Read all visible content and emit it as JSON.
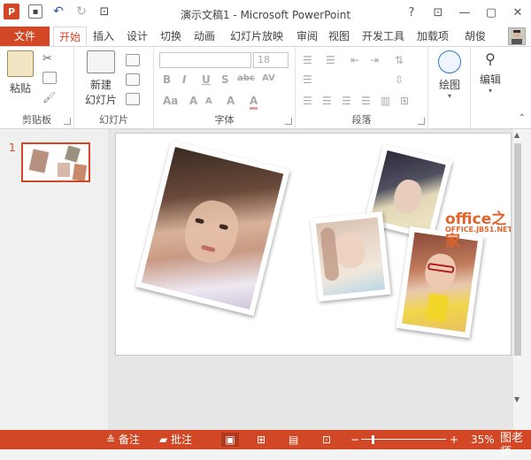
{
  "app": {
    "window_title": "演示文稿1 - Microsoft PowerPoint",
    "logo_letter": "P"
  },
  "tabs": [
    {
      "label": "文件",
      "type": "file"
    },
    {
      "label": "开始",
      "type": "active"
    },
    {
      "label": "插入"
    },
    {
      "label": "设计"
    },
    {
      "label": "切换"
    },
    {
      "label": "动画"
    },
    {
      "label": "幻灯片放映"
    },
    {
      "label": "审阅"
    },
    {
      "label": "视图"
    },
    {
      "label": "开发工具"
    },
    {
      "label": "加载项"
    },
    {
      "label": "胡俊"
    }
  ],
  "ribbon": {
    "clipboard": {
      "paste_label": "粘贴",
      "group_label": "剪贴板"
    },
    "slides": {
      "new_slide_label_1": "新建",
      "new_slide_label_2": "幻灯片",
      "group_label": "幻灯片"
    },
    "font": {
      "font_name_value": "",
      "font_size_value": "18",
      "group_label": "字体",
      "bold": "B",
      "italic": "I",
      "underline": "U",
      "shadow": "S",
      "strike": "abc",
      "spacing": "AV",
      "case": "Aa",
      "grow": "A",
      "shrink": "A",
      "clear": "A",
      "color": "A"
    },
    "paragraph": {
      "group_label": "段落"
    },
    "drawing": {
      "label": "绘图"
    },
    "editing": {
      "label": "编辑"
    }
  },
  "thumbnails": [
    {
      "number": "1"
    }
  ],
  "status": {
    "notes_label": "备注",
    "comments_label": "批注",
    "zoom_minus": "−",
    "zoom_plus": "+",
    "zoom_value": "35%",
    "zoom_level": 0.35
  },
  "watermark": {
    "main": "office之家",
    "sub": "OFFICE.JB51.NET",
    "corner": "图老师"
  },
  "colors": {
    "accent": "#d24726",
    "status_bg": "#d24726"
  }
}
